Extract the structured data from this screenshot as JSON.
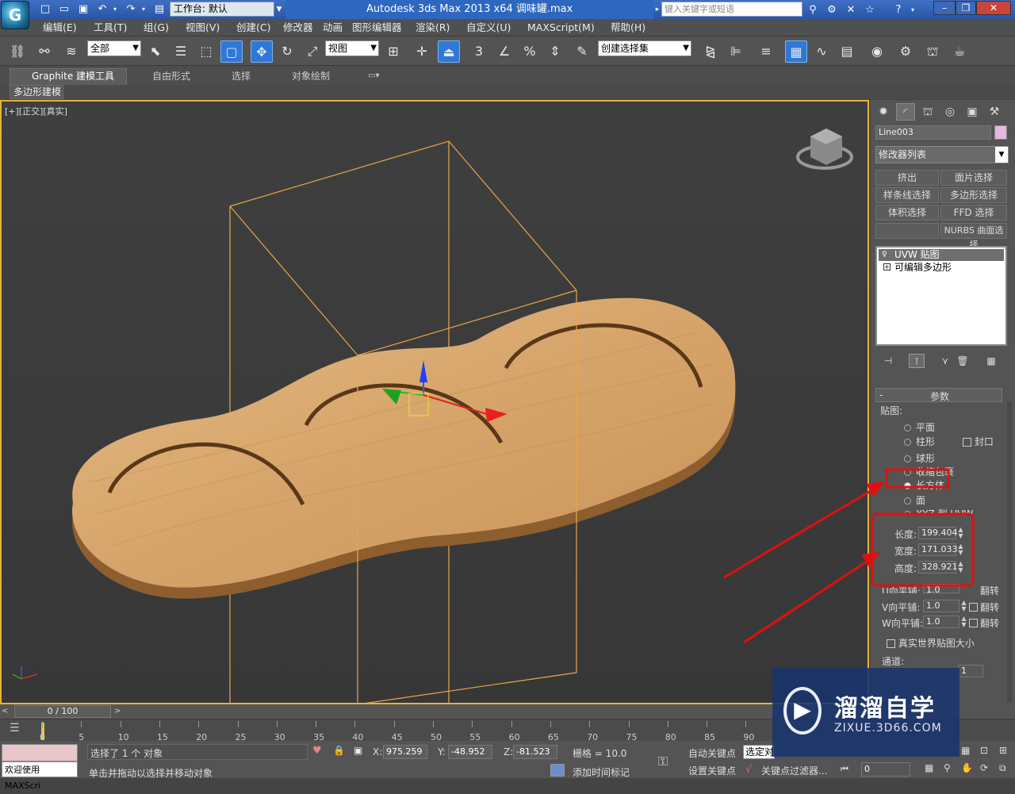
{
  "titlebar": {
    "workspace_label": "工作台: 默认",
    "title": "Autodesk 3ds Max  2013 x64      调味罐.max",
    "search_placeholder": "键入关键字或短语"
  },
  "menu": [
    "编辑(E)",
    "工具(T)",
    "组(G)",
    "视图(V)",
    "创建(C)",
    "修改器",
    "动画",
    "图形编辑器",
    "渲染(R)",
    "自定义(U)",
    "MAXScript(M)",
    "帮助(H)"
  ],
  "toolbar": {
    "selection_filter": "全部",
    "ref_coord": "视图",
    "named_selection": "创建选择集"
  },
  "ribbon": {
    "tabs": [
      "Graphite 建模工具",
      "自由形式",
      "选择",
      "对象绘制"
    ],
    "subpanel": "多边形建模"
  },
  "viewport": {
    "label": "[+][正交][真实]"
  },
  "command_panel": {
    "object_name": "Line003",
    "object_color": "#e6b7e0",
    "modifier_list": "修改器列表",
    "mod_buttons": [
      [
        "挤出",
        "面片选择"
      ],
      [
        "样条线选择",
        "多边形选择"
      ],
      [
        "体积选择",
        "FFD 选择"
      ],
      [
        "",
        "NURBS 曲面选择"
      ]
    ],
    "stack": [
      "UVW 贴图",
      "可编辑多边形"
    ],
    "params_title": "参数",
    "mapping_label": "贴图:",
    "mapping_options": [
      "平面",
      "柱形",
      "球形",
      "收缩包裹",
      "长方体",
      "面",
      "XYZ 到 UVW"
    ],
    "mapping_selected": "长方体",
    "cap_label": "封口",
    "length_label": "长度:",
    "length": "199.404",
    "width_label": "宽度:",
    "width": "171.033",
    "height_label": "高度:",
    "height": "328.921",
    "u_tile_label": "U向平铺:",
    "u_tile": "1.0",
    "v_tile_label": "V向平铺:",
    "v_tile": "1.0",
    "w_tile_label": "W向平铺:",
    "w_tile": "1.0",
    "flip_label": "翻转",
    "real_world_label": "真实世界贴图大小",
    "channel_label": "通道:",
    "channel_value": "1"
  },
  "timeline": {
    "frame": "0 / 100",
    "ticks": [
      "0",
      "5",
      "10",
      "15",
      "20",
      "25",
      "30",
      "35",
      "40",
      "45",
      "50",
      "55",
      "60",
      "65",
      "70",
      "75",
      "80",
      "85",
      "90"
    ]
  },
  "status": {
    "maxscript_text": "欢迎使用 MAXScri",
    "selected": "选择了 1 个 对象",
    "prompt": "单击并拖动以选择并移动对象",
    "x_label": "X:",
    "x": "975.259",
    "y_label": "Y:",
    "y": "-48.952",
    "z_label": "Z:",
    "z": "-81.523",
    "grid": "栅格 = 10.0",
    "add_time_tag": "添加时间标记",
    "auto_key": "自动关键点",
    "set_key": "设置关键点",
    "selected_obj": "选定对",
    "key_filters": "关键点过滤器...",
    "frame_input": "0"
  },
  "watermark": {
    "name": "溜溜自学",
    "url": "ZIXUE.3D66.COM"
  },
  "colors": {
    "highlight_red": "#e01010",
    "selection_orange": "#e8b23a",
    "wood": "#d9a86c"
  }
}
